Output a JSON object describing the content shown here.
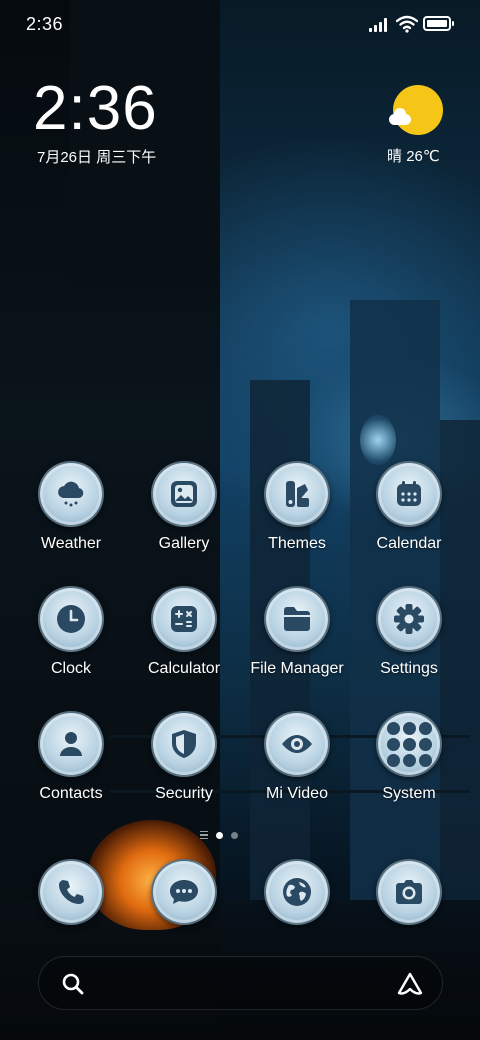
{
  "status_bar": {
    "time": "2:36",
    "battery_level": 1.0
  },
  "clock_widget": {
    "time": "2:36",
    "date": "7月26日 周三下午"
  },
  "weather_widget": {
    "condition": "晴",
    "temperature": "26℃",
    "icon": "sun-cloud-icon"
  },
  "apps": [
    {
      "label": "Weather",
      "icon": "weather-cloud-icon"
    },
    {
      "label": "Gallery",
      "icon": "image-icon"
    },
    {
      "label": "Themes",
      "icon": "themes-palette-icon"
    },
    {
      "label": "Calendar",
      "icon": "calendar-icon"
    },
    {
      "label": "Clock",
      "icon": "clock-icon"
    },
    {
      "label": "Calculator",
      "icon": "calculator-icon"
    },
    {
      "label": "File Manager",
      "icon": "folder-icon"
    },
    {
      "label": "Settings",
      "icon": "gear-icon"
    },
    {
      "label": "Contacts",
      "icon": "person-icon"
    },
    {
      "label": "Security",
      "icon": "shield-icon"
    },
    {
      "label": "Mi Video",
      "icon": "eye-icon"
    },
    {
      "label": "System",
      "icon": "folder-grid-icon"
    }
  ],
  "page_indicator": {
    "pages": 2,
    "current": 1
  },
  "dock": [
    {
      "icon": "phone-icon"
    },
    {
      "icon": "message-icon"
    },
    {
      "icon": "globe-icon"
    },
    {
      "icon": "camera-icon"
    }
  ],
  "search_bar": {
    "left_icon": "search-icon",
    "right_icon": "assistant-icon"
  },
  "colors": {
    "icon_glyph": "#2a4a63",
    "sun": "#f5c518"
  }
}
